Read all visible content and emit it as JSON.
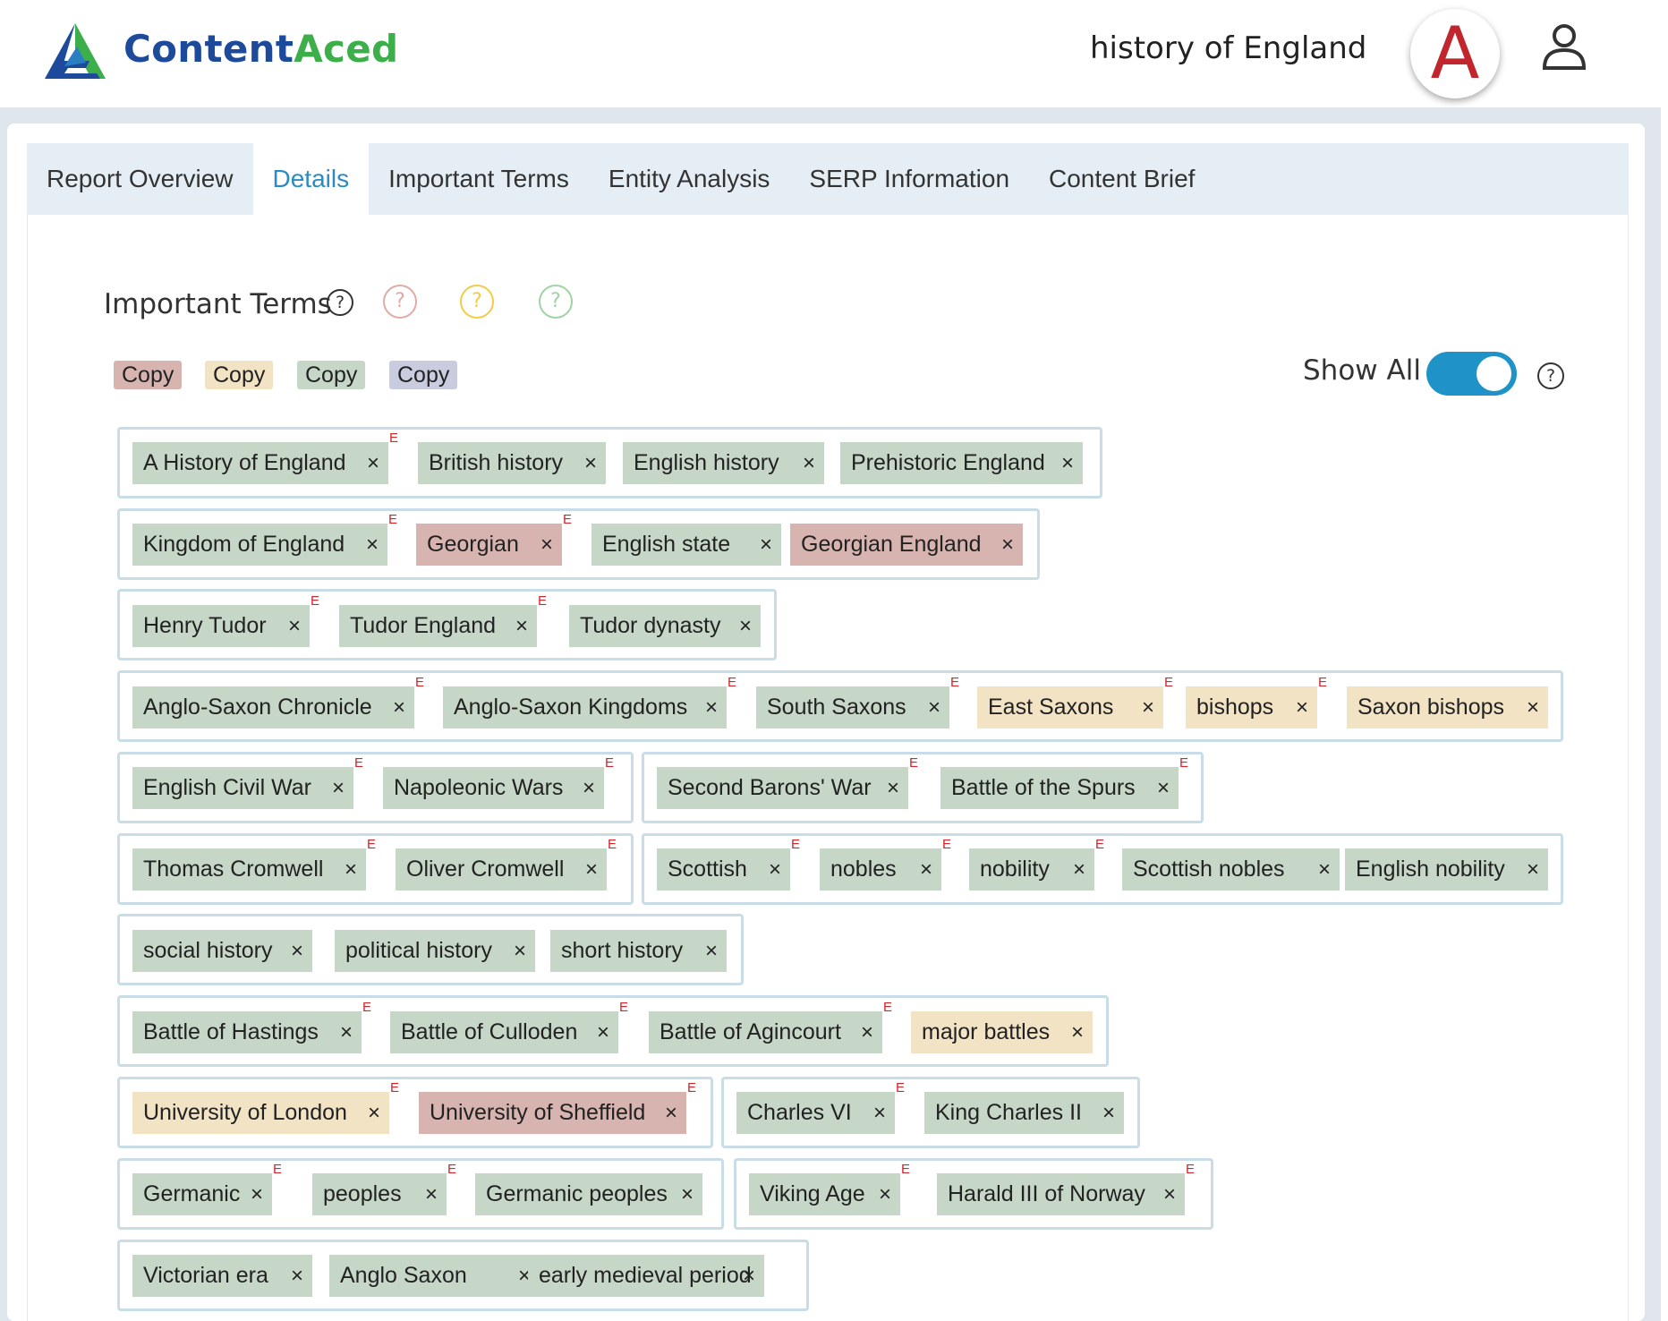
{
  "brand": {
    "part1": "Content",
    "part2": "Aced"
  },
  "header": {
    "title": "history of England",
    "avatar_letter": "A"
  },
  "tabs": [
    {
      "label": "Report Overview",
      "active": false
    },
    {
      "label": "Details",
      "active": true
    },
    {
      "label": "Important Terms",
      "active": false
    },
    {
      "label": "Entity Analysis",
      "active": false
    },
    {
      "label": "SERP Information",
      "active": false
    },
    {
      "label": "Content Brief",
      "active": false
    }
  ],
  "section": {
    "title": "Important Terms",
    "help_glyph": "?"
  },
  "copy_buttons": [
    {
      "label": "Copy",
      "color": "#d8b4b1"
    },
    {
      "label": "Copy",
      "color": "#f2e3c5"
    },
    {
      "label": "Copy",
      "color": "#c6d7c7"
    },
    {
      "label": "Copy",
      "color": "#c8ccde"
    }
  ],
  "show_all": {
    "label": "Show All",
    "on": true
  },
  "colors": {
    "green": "#c6d7c7",
    "tan": "#f2e3c5",
    "rose": "#d8b4b1",
    "entity_marker": "#d0262c",
    "accent": "#1f93c8"
  },
  "remove_glyph": "×",
  "entity_marker": "E",
  "term_groups": [
    {
      "terms": [
        {
          "label": "A History of England",
          "color": "green",
          "entity": true
        },
        {
          "label": "British history",
          "color": "green",
          "entity": false
        },
        {
          "label": "English history",
          "color": "green",
          "entity": false
        },
        {
          "label": "Prehistoric England",
          "color": "green",
          "entity": false
        }
      ]
    },
    {
      "terms": [
        {
          "label": "Kingdom of England",
          "color": "green",
          "entity": true
        },
        {
          "label": "Georgian",
          "color": "rose",
          "entity": true
        },
        {
          "label": "English state",
          "color": "green",
          "entity": false
        },
        {
          "label": "Georgian England",
          "color": "rose",
          "entity": false
        }
      ]
    },
    {
      "terms": [
        {
          "label": "Henry Tudor",
          "color": "green",
          "entity": true
        },
        {
          "label": "Tudor England",
          "color": "green",
          "entity": true
        },
        {
          "label": "Tudor dynasty",
          "color": "green",
          "entity": false
        }
      ]
    },
    {
      "terms": [
        {
          "label": "Anglo-Saxon Chronicle",
          "color": "green",
          "entity": true
        },
        {
          "label": "Anglo-Saxon Kingdoms",
          "color": "green",
          "entity": true
        },
        {
          "label": "South Saxons",
          "color": "green",
          "entity": true
        },
        {
          "label": "East Saxons",
          "color": "tan",
          "entity": true
        },
        {
          "label": "bishops",
          "color": "tan",
          "entity": true
        },
        {
          "label": "Saxon bishops",
          "color": "tan",
          "entity": false
        }
      ]
    },
    {
      "terms": [
        {
          "label": "English Civil War",
          "color": "green",
          "entity": true
        },
        {
          "label": "Napoleonic Wars",
          "color": "green",
          "entity": true
        }
      ]
    },
    {
      "terms": [
        {
          "label": "Second Barons' War",
          "color": "green",
          "entity": true
        },
        {
          "label": "Battle of the Spurs",
          "color": "green",
          "entity": true
        }
      ]
    },
    {
      "terms": [
        {
          "label": "Thomas Cromwell",
          "color": "green",
          "entity": true
        },
        {
          "label": "Oliver Cromwell",
          "color": "green",
          "entity": true
        }
      ]
    },
    {
      "terms": [
        {
          "label": "Scottish",
          "color": "green",
          "entity": true
        },
        {
          "label": "nobles",
          "color": "green",
          "entity": true
        },
        {
          "label": "nobility",
          "color": "green",
          "entity": true
        },
        {
          "label": "Scottish nobles",
          "color": "green",
          "entity": false
        },
        {
          "label": "English nobility",
          "color": "green",
          "entity": false
        }
      ]
    },
    {
      "terms": [
        {
          "label": "social history",
          "color": "green",
          "entity": false
        },
        {
          "label": "political history",
          "color": "green",
          "entity": false
        },
        {
          "label": "short history",
          "color": "green",
          "entity": false
        }
      ]
    },
    {
      "terms": [
        {
          "label": "Battle of Hastings",
          "color": "green",
          "entity": true
        },
        {
          "label": "Battle of Culloden",
          "color": "green",
          "entity": true
        },
        {
          "label": "Battle of Agincourt",
          "color": "green",
          "entity": true
        },
        {
          "label": "major battles",
          "color": "tan",
          "entity": false
        }
      ]
    },
    {
      "terms": [
        {
          "label": "University of London",
          "color": "tan",
          "entity": true
        },
        {
          "label": "University of Sheffield",
          "color": "rose",
          "entity": true
        }
      ]
    },
    {
      "terms": [
        {
          "label": "Charles VI",
          "color": "green",
          "entity": true
        },
        {
          "label": "King Charles II",
          "color": "green",
          "entity": false
        }
      ]
    },
    {
      "terms": [
        {
          "label": "Germanic",
          "color": "green",
          "entity": true
        },
        {
          "label": "peoples",
          "color": "green",
          "entity": true
        },
        {
          "label": "Germanic peoples",
          "color": "green",
          "entity": false
        }
      ]
    },
    {
      "terms": [
        {
          "label": "Viking Age",
          "color": "green",
          "entity": true
        },
        {
          "label": "Harald III of Norway",
          "color": "green",
          "entity": true
        }
      ]
    },
    {
      "terms": [
        {
          "label": "Victorian era",
          "color": "green",
          "entity": false
        },
        {
          "label": "Anglo Saxon",
          "color": "green",
          "entity": false
        },
        {
          "label": "early medieval period",
          "color": "green",
          "entity": false
        }
      ]
    }
  ]
}
